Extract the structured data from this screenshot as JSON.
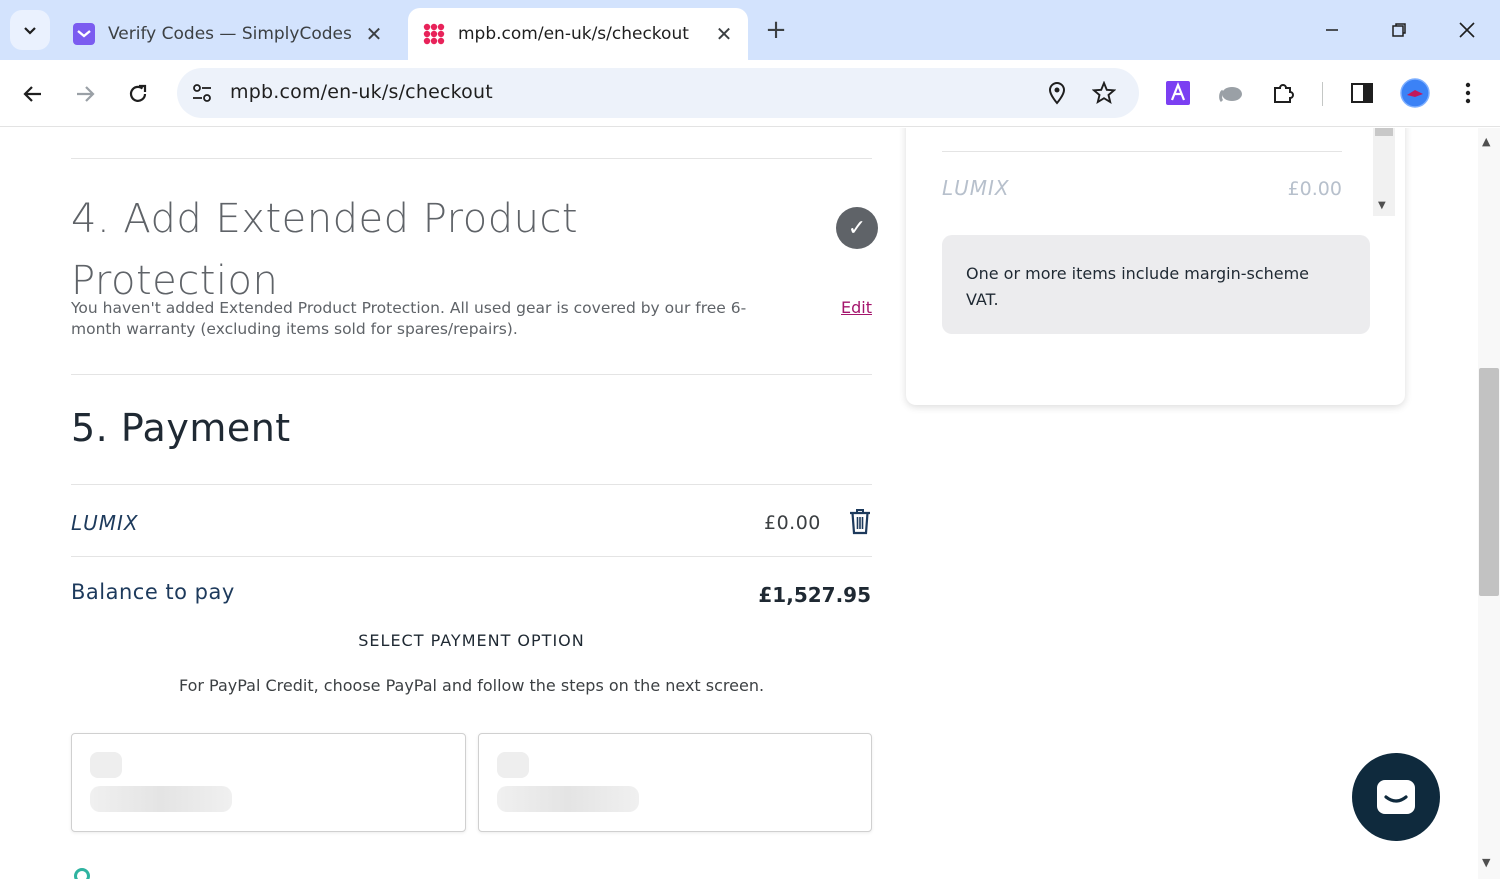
{
  "browser": {
    "tabs": [
      {
        "title": "Verify Codes — SimplyCodes",
        "active": false
      },
      {
        "title": "mpb.com/en-uk/s/checkout",
        "active": true
      }
    ],
    "url": "mpb.com/en-uk/s/checkout",
    "accent": "#d3e3fd"
  },
  "section4": {
    "title": "4. Add Extended Product Protection",
    "description": "You haven't added Extended Product Protection. All used gear is covered by our free 6-month warranty (excluding items sold for spares/repairs).",
    "edit_label": "Edit"
  },
  "section5": {
    "title": "5. Payment",
    "item_name": "LUMIX",
    "item_price": "£0.00",
    "balance_label": "Balance to pay",
    "balance_value": "£1,527.95",
    "select_option_label": "SELECT PAYMENT OPTION",
    "paypal_note": "For PayPal Credit, choose PayPal and follow the steps on the next screen."
  },
  "summary": {
    "item_name": "LUMIX",
    "item_price": "£0.00",
    "vat_note": "One or more items include margin-scheme VAT."
  },
  "colors": {
    "link": "#a4146c",
    "chat": "#0f2a3d"
  }
}
